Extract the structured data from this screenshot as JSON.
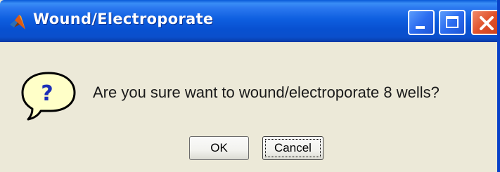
{
  "window": {
    "title": "Wound/Electroporate",
    "title_icon": "matlab-logo-icon"
  },
  "titlebar_buttons": [
    {
      "name": "minimize",
      "icon": "minimize-icon"
    },
    {
      "name": "maximize",
      "icon": "maximize-icon"
    },
    {
      "name": "close",
      "icon": "close-icon"
    }
  ],
  "dialog": {
    "icon": "question-icon",
    "message": "Are you sure want to wound/electroporate 8 wells?",
    "ok_label": "OK",
    "cancel_label": "Cancel"
  },
  "colors": {
    "titlebar": "#0a4fcc",
    "body": "#ece9d8",
    "close_button": "#e0502a",
    "question_bubble": "#ffffc8"
  }
}
